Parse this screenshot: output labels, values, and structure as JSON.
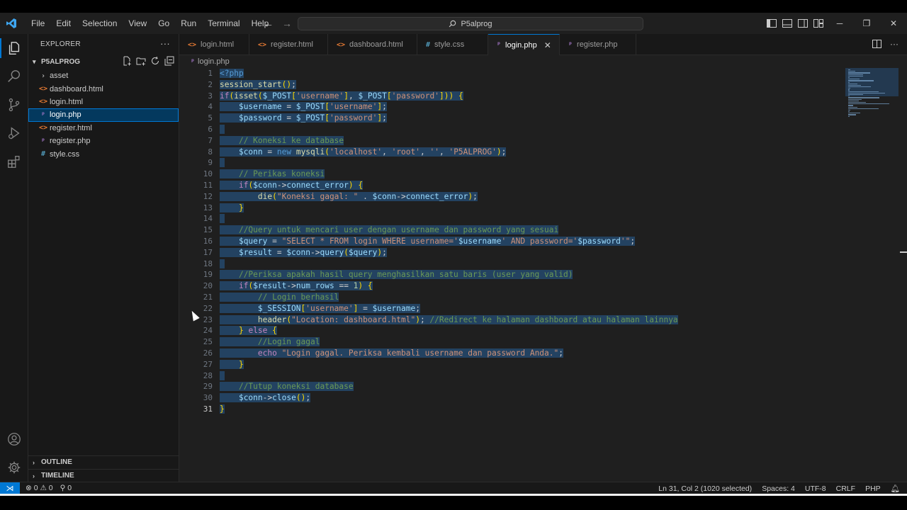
{
  "window": {
    "search_text": "P5alprog",
    "menu": [
      "File",
      "Edit",
      "Selection",
      "View",
      "Go",
      "Run",
      "Terminal",
      "Help"
    ]
  },
  "explorer": {
    "title": "EXPLORER",
    "folder": "P5ALPROG",
    "items": [
      {
        "label": "asset",
        "type": "folder"
      },
      {
        "label": "dashboard.html",
        "type": "html"
      },
      {
        "label": "login.html",
        "type": "html"
      },
      {
        "label": "login.php",
        "type": "php"
      },
      {
        "label": "register.html",
        "type": "html"
      },
      {
        "label": "register.php",
        "type": "php"
      },
      {
        "label": "style.css",
        "type": "css"
      }
    ],
    "outline": "OUTLINE",
    "timeline": "TIMELINE"
  },
  "tabs": [
    {
      "label": "login.html",
      "type": "html"
    },
    {
      "label": "register.html",
      "type": "html"
    },
    {
      "label": "dashboard.html",
      "type": "html"
    },
    {
      "label": "style.css",
      "type": "css"
    },
    {
      "label": "login.php",
      "type": "php",
      "active": true
    },
    {
      "label": "register.php",
      "type": "php"
    }
  ],
  "breadcrumb": "login.php",
  "editor": {
    "line_numbers": [
      "1",
      "2",
      "3",
      "4",
      "5",
      "6",
      "7",
      "8",
      "9",
      "10",
      "11",
      "12",
      "13",
      "14",
      "15",
      "16",
      "17",
      "18",
      "19",
      "20",
      "21",
      "22",
      "23",
      "24",
      "25",
      "26",
      "27",
      "28",
      "29",
      "30",
      "31"
    ],
    "lines": [
      "<?php",
      "session_start();",
      "if(isset($_POST['username'], $_POST['password'])) {",
      "    $username = $_POST['username'];",
      "    $password = $_POST['password'];",
      "",
      "    // Koneksi ke database",
      "    $conn = new mysqli('localhost', 'root', '', 'P5ALPROG');",
      "",
      "    // Perikas koneksi",
      "    if($conn->connect_error) {",
      "        die(\"Koneksi gagal: \" . $conn->connect_error);",
      "    }",
      "",
      "    //Query untuk mencari user dengan username dan password yang sesuai",
      "    $query = \"SELECT * FROM login WHERE username='$username' AND password='$password'\";",
      "    $result = $conn->query($query);",
      "",
      "    //Periksa apakah hasil query menghasilkan satu baris (user yang valid)",
      "    if($result->num_rows == 1) {",
      "        // Login berhasil",
      "        $_SESSION['username'] = $username;",
      "        header(\"Location: dashboard.html\"); //Redirect ke halaman dashboard atau halaman lainnya",
      "    } else {",
      "        //Login gagal",
      "        echo \"Login gagal. Periksa kembali username dan password Anda.\";",
      "    }",
      "",
      "    //Tutup koneksi database",
      "    $conn->close();",
      "}"
    ]
  },
  "statusbar": {
    "problems": "⊗ 0 ⚠ 0",
    "ports": "⚲ 0",
    "position": "Ln 31, Col 2 (1020 selected)",
    "spaces": "Spaces: 4",
    "encoding": "UTF-8",
    "eol": "CRLF",
    "language": "PHP"
  },
  "colors": {
    "accent": "#0078d4",
    "selection": "#264f78",
    "html_icon": "#e37933",
    "php_icon": "#a074c4",
    "css_icon": "#519aba"
  }
}
